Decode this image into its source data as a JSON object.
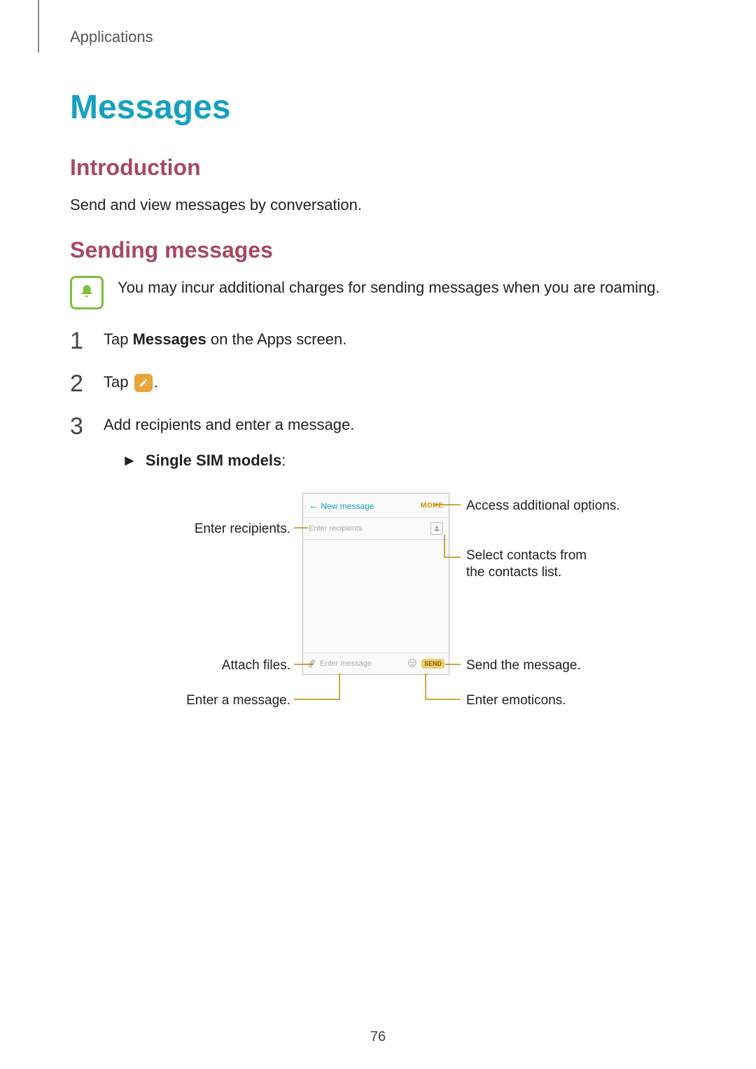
{
  "breadcrumb": "Applications",
  "title": "Messages",
  "intro": {
    "heading": "Introduction",
    "text": "Send and view messages by conversation."
  },
  "sending": {
    "heading": "Sending messages",
    "note": "You may incur additional charges for sending messages when you are roaming.",
    "steps": {
      "s1_pre": "Tap ",
      "s1_strong": "Messages",
      "s1_post": " on the Apps screen.",
      "s2_pre": "Tap ",
      "s2_post": ".",
      "s3": "Add recipients and enter a message.",
      "sub_pre": "► ",
      "sub_strong": "Single SIM models",
      "sub_post": ":"
    }
  },
  "diagram": {
    "phone": {
      "back_glyph": "←",
      "title": "New message",
      "more": "MORE",
      "recipients_placeholder": "Enter recipients",
      "message_placeholder": "Enter message",
      "send_label": "SEND"
    },
    "labels": {
      "enter_recipients": "Enter recipients.",
      "attach_files": "Attach files.",
      "enter_a_message": "Enter a message.",
      "access_options": "Access additional options.",
      "select_contacts": "Select contacts from the contacts list.",
      "send_message": "Send the message.",
      "enter_emoticons": "Enter emoticons."
    }
  },
  "page_number": "76"
}
